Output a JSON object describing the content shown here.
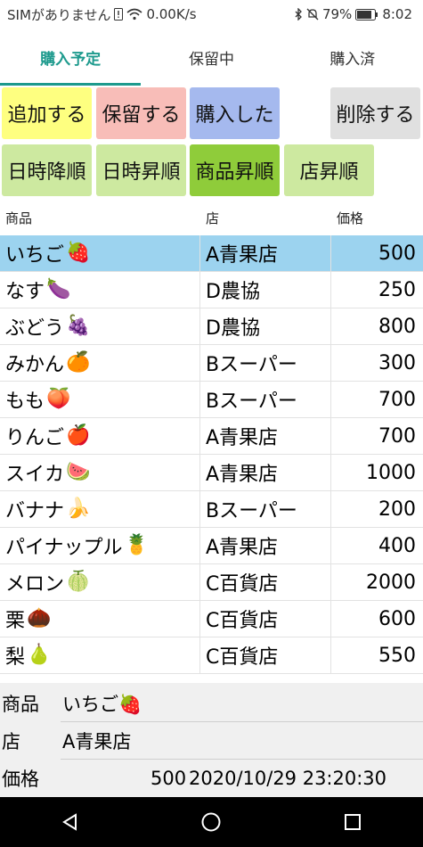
{
  "status_bar": {
    "carrier": "SIMがありません",
    "speed": "0.00K/s",
    "battery": "79%",
    "time": "8:02",
    "icons": [
      "sim-alert-icon",
      "wifi-icon",
      "bluetooth-icon",
      "mute-icon",
      "battery-icon"
    ]
  },
  "tabs": [
    {
      "label": "購入予定"
    },
    {
      "label": "保留中"
    },
    {
      "label": "購入済"
    }
  ],
  "actions": {
    "add": "追加する",
    "hold": "保留する",
    "bought": "購入した",
    "delete": "削除する"
  },
  "sort": {
    "date_desc": "日時降順",
    "date_asc": "日時昇順",
    "item_asc": "商品昇順",
    "shop_asc": "店昇順"
  },
  "colors": {
    "add": "#feff80",
    "hold": "#f8bdb8",
    "bought": "#a5b9ee",
    "delete": "#e0e0e0",
    "sort": "#cde9a0",
    "sort_active": "#8fcc3a",
    "selected_row": "#9cd3ef",
    "accent": "#1d9a8d"
  },
  "table": {
    "headers": [
      "商品",
      "店",
      "価格"
    ],
    "rows": [
      {
        "name": "いちご",
        "emoji": "🍓",
        "shop": "A青果店",
        "price": "500"
      },
      {
        "name": "なす",
        "emoji": "🍆",
        "shop": "D農協",
        "price": "250"
      },
      {
        "name": "ぶどう",
        "emoji": "🍇",
        "shop": "D農協",
        "price": "800"
      },
      {
        "name": "みかん",
        "emoji": "🍊",
        "shop": "Bスーパー",
        "price": "300"
      },
      {
        "name": "もも",
        "emoji": "🍑",
        "shop": "Bスーパー",
        "price": "700"
      },
      {
        "name": "りんご",
        "emoji": "🍎",
        "shop": "A青果店",
        "price": "700"
      },
      {
        "name": "スイカ",
        "emoji": "🍉",
        "shop": "A青果店",
        "price": "1000"
      },
      {
        "name": "バナナ",
        "emoji": "🍌",
        "shop": "Bスーパー",
        "price": "200"
      },
      {
        "name": "パイナップル",
        "emoji": "🍍",
        "shop": "A青果店",
        "price": "400"
      },
      {
        "name": "メロン",
        "emoji": "🍈",
        "shop": "C百貨店",
        "price": "2000"
      },
      {
        "name": "栗",
        "emoji": "🌰",
        "shop": "C百貨店",
        "price": "600"
      },
      {
        "name": "梨",
        "emoji": "🍐",
        "shop": "C百貨店",
        "price": "550"
      }
    ]
  },
  "detail": {
    "item_label": "商品",
    "item_value": "いちご🍓",
    "shop_label": "店",
    "shop_value": "A青果店",
    "price_label": "価格",
    "price_value": "500",
    "datetime": "2020/10/29 23:20:30"
  }
}
